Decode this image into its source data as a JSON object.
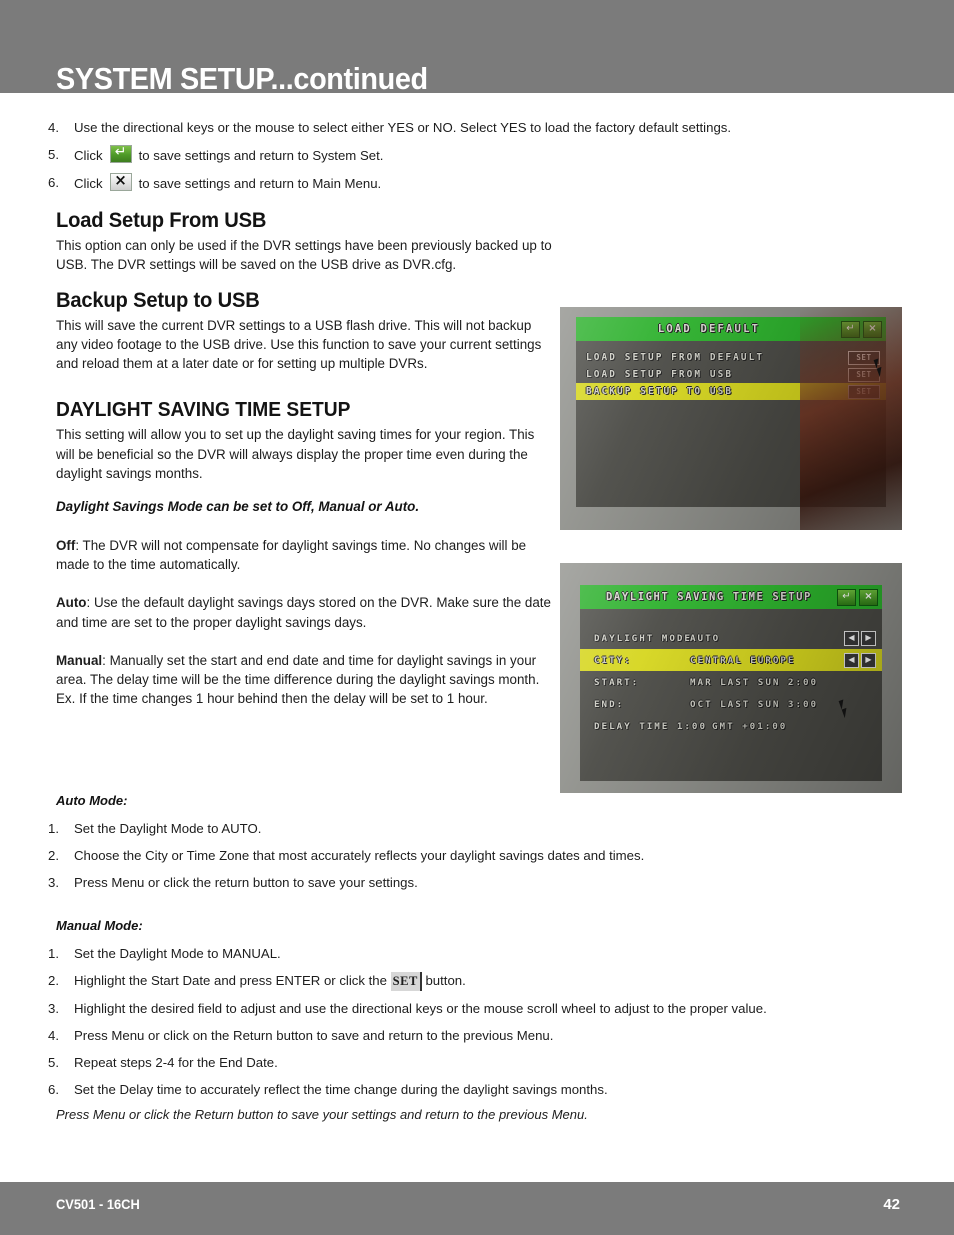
{
  "header": {
    "title": "SYSTEM SETUP...continued"
  },
  "footer": {
    "model": "CV501 - 16CH",
    "page": "42"
  },
  "top_steps": [
    {
      "num": "4.",
      "text": "Use the directional keys or the mouse to select either YES or NO. Select YES to load the factory default settings."
    },
    {
      "num": "5.",
      "pre": "Click",
      "icon": "enter-icon",
      "post": "to save settings and return to System Set."
    },
    {
      "num": "6.",
      "pre": "Click",
      "icon": "close-icon",
      "post": "to save settings and return to Main Menu."
    }
  ],
  "sections": {
    "load_setup": {
      "heading": "Load Setup From USB",
      "body": "This option can only be used if the DVR settings have been previously backed up to USB. The DVR settings will be saved on the USB drive as DVR.cfg."
    },
    "backup_setup": {
      "heading": "Backup Setup to USB",
      "body": "This will save the current DVR settings to a USB flash drive. This will not backup any video footage to the USB drive. Use this function to save your current settings and reload them at a later date or for setting up multiple DVRs."
    },
    "dst": {
      "heading": "DAYLIGHT SAVING TIME SETUP",
      "body": "This setting will allow you to set up the daylight saving times for your region. This will be beneficial so the DVR will always display the proper time even during the daylight savings months.",
      "mode_note": "Daylight Savings Mode can be set to Off, Manual or Auto.",
      "off_label": "Off",
      "off_text": ": The DVR will not compensate for daylight savings time. No changes will be made to the time automatically.",
      "auto_label": "Auto",
      "auto_text": ": Use the default daylight savings days stored on the DVR. Make sure the date and time are set to the proper daylight savings days.",
      "manual_label": "Manual",
      "manual_text": ": Manually set the start and end date and time for daylight savings in your area. The delay time will be the time difference during the daylight savings month. Ex. If the time changes 1 hour behind then the delay will be set to 1 hour."
    }
  },
  "auto_mode": {
    "heading": "Auto Mode:",
    "steps": [
      {
        "num": "1.",
        "text": "Set the Daylight Mode to AUTO."
      },
      {
        "num": "2.",
        "text": "Choose the City or Time Zone that most accurately reflects your daylight savings dates and times."
      },
      {
        "num": "3.",
        "text": "Press Menu or click the return button to save your settings."
      }
    ]
  },
  "manual_mode": {
    "heading": "Manual Mode:",
    "steps": [
      {
        "num": "1.",
        "text": "Set the Daylight Mode to MANUAL."
      },
      {
        "num": "2.",
        "pre": "Highlight the Start Date and press ENTER or click the",
        "badge": "SET",
        "post": "button."
      },
      {
        "num": "3.",
        "text": "Highlight the desired field to adjust and use the directional keys or the mouse scroll wheel to adjust to the proper value."
      },
      {
        "num": "4.",
        "text": "Press Menu or click on the Return button to save and return to the previous Menu."
      },
      {
        "num": "5.",
        "text": "Repeat steps 2-4 for the End Date."
      },
      {
        "num": "6.",
        "text": "Set the Delay time to accurately reflect the time change during the daylight savings months."
      }
    ],
    "closing_note": "Press Menu or click the Return button to save your settings and return to the previous Menu."
  },
  "osd_load_default": {
    "title": "LOAD DEFAULT",
    "title_buttons": [
      "return-icon",
      "close-icon"
    ],
    "rows": [
      {
        "label": "LOAD SETUP FROM DEFAULT",
        "button": "SET",
        "highlighted": false
      },
      {
        "label": "LOAD SETUP FROM USB",
        "button": "SET",
        "highlighted": false
      },
      {
        "label": "BACKUP SETUP TO USB",
        "button": "SET",
        "highlighted": true
      }
    ]
  },
  "osd_dst_setup": {
    "title": "DAYLIGHT SAVING TIME SETUP",
    "title_buttons": [
      "return-icon",
      "close-icon"
    ],
    "fields": [
      {
        "name": "DAYLIGHT MODE",
        "value": "AUTO",
        "arrows": true,
        "highlighted": false
      },
      {
        "name": "CITY:",
        "value": "CENTRAL EUROPE",
        "arrows": true,
        "highlighted": true
      },
      {
        "name": "START:",
        "value": "MAR LAST SUN   2:00",
        "arrows": false,
        "highlighted": false
      },
      {
        "name": "END:",
        "value": "OCT LAST SUN   3:00",
        "arrows": false,
        "highlighted": false
      },
      {
        "name": "DELAY TIME 1:00",
        "value": "GMT +01:00",
        "arrows": false,
        "highlighted": false
      }
    ]
  },
  "colors": {
    "header_gray": "#7b7b7b",
    "osd_green": "#2bb02b",
    "osd_highlight": "#d6d61e",
    "osd_panel": "#4a4a45"
  }
}
